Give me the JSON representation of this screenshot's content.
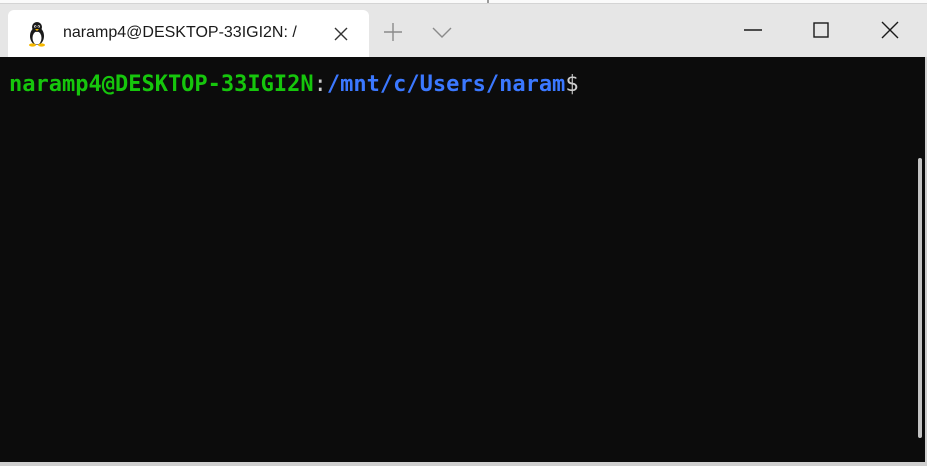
{
  "tab": {
    "title": "naramp4@DESKTOP-33IGI2N: /",
    "icon": "linux-penguin-icon",
    "close_icon": "close-icon"
  },
  "toolbar": {
    "new_tab_icon": "plus-icon",
    "dropdown_icon": "chevron-down-icon"
  },
  "window_controls": {
    "minimize_icon": "minimize-icon",
    "maximize_icon": "maximize-icon",
    "close_icon": "close-icon"
  },
  "terminal": {
    "user_host": "naramp4@DESKTOP-33IGI2N",
    "separator": ":",
    "path": "/mnt/c/Users/naram",
    "prompt_symbol": "$",
    "colors": {
      "user_host": "#16c60c",
      "path": "#3b78ff",
      "text": "#cccccc",
      "background": "#0c0c0c"
    }
  }
}
